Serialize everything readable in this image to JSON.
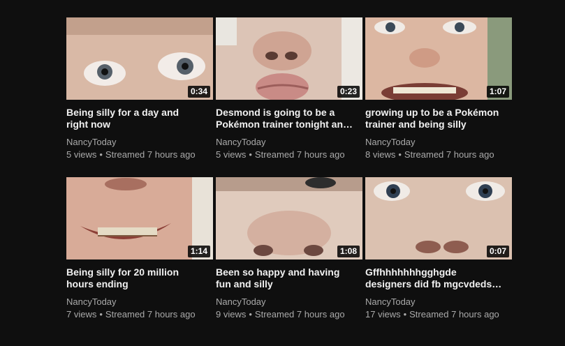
{
  "videos": [
    {
      "title": "Being silly for a day and right now",
      "duration": "0:34",
      "channel": "NancyToday",
      "views": "5 views",
      "streamed": "Streamed 7 hours ago"
    },
    {
      "title": "Desmond is going to be a Pokémon trainer tonight an…",
      "duration": "0:23",
      "channel": "NancyToday",
      "views": "5 views",
      "streamed": "Streamed 7 hours ago"
    },
    {
      "title": "growing up to be a Pokémon trainer and being silly",
      "duration": "1:07",
      "channel": "NancyToday",
      "views": "8 views",
      "streamed": "Streamed 7 hours ago"
    },
    {
      "title": "Being silly for 20 million hours ending",
      "duration": "1:14",
      "channel": "NancyToday",
      "views": "7 views",
      "streamed": "Streamed 7 hours ago"
    },
    {
      "title": "Been so happy and having fun and silly",
      "duration": "1:08",
      "channel": "NancyToday",
      "views": "9 views",
      "streamed": "Streamed 7 hours ago"
    },
    {
      "title": "Gffhhhhhhhgghgde designers did fb mgcvdeds. Desi",
      "duration": "0:07",
      "channel": "NancyToday",
      "views": "17 views",
      "streamed": "Streamed 7 hours ago"
    }
  ],
  "separator": "•"
}
